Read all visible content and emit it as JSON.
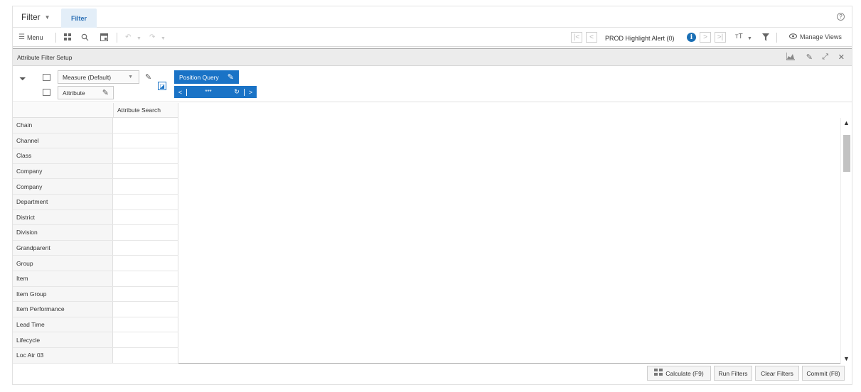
{
  "title_bar": {
    "dropdown_label": "Filter",
    "active_tab": "Filter",
    "help_icon": "?"
  },
  "toolbar": {
    "menu_label": "Menu",
    "highlight_alert_label": "PROD Highlight Alert (0)",
    "info_icon": "i",
    "text_size_icon": "тT",
    "manage_views_label": "Manage Views"
  },
  "panel": {
    "title": "Attribute Filter Setup"
  },
  "pivot": {
    "measure_label": "Measure (Default)",
    "attribute_label": "Attribute",
    "position_query_label": "Position Query",
    "nav_ellipsis": "***"
  },
  "grid": {
    "column_header": "Attribute Search",
    "rows": [
      "Chain",
      "Channel",
      "Class",
      "Company",
      "Company",
      "Department",
      "District",
      "Division",
      "Grandparent",
      "Group",
      "Item",
      "Item Group",
      "Item Performance",
      "Lead Time",
      "Lifecycle",
      "Loc Atr 03"
    ]
  },
  "footer": {
    "calculate_label": "Calculate (F9)",
    "run_filters_label": "Run Filters",
    "clear_filters_label": "Clear Filters",
    "commit_label": "Commit (F8)"
  },
  "colors": {
    "accent": "#1a73c6",
    "tab_bg": "#e3eef8",
    "panel_header_bg": "#ececec"
  }
}
